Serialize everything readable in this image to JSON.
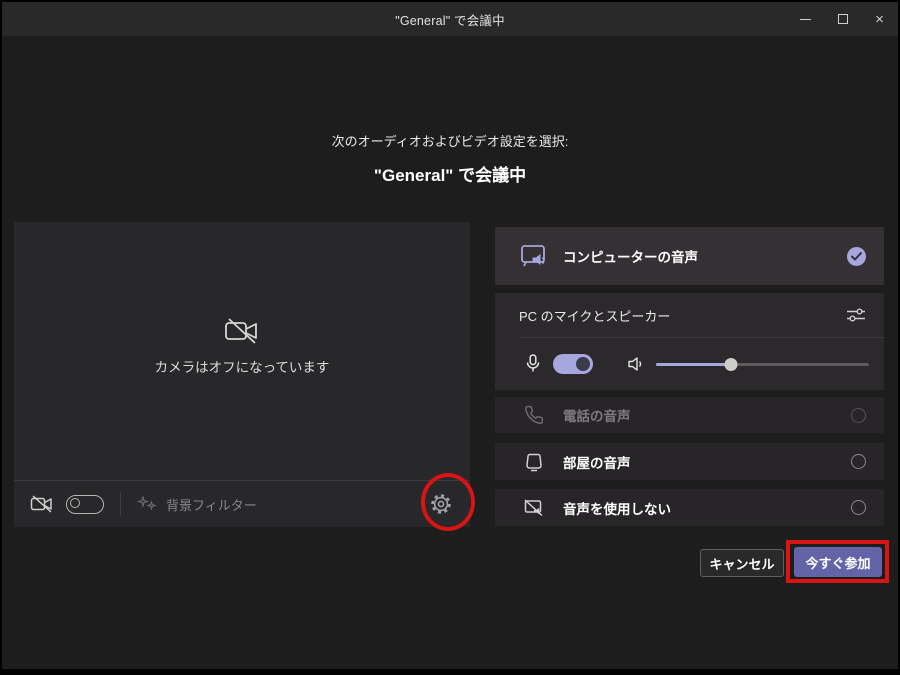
{
  "window": {
    "title": "\"General\" で会議中",
    "controls": {
      "minimize": "minimize",
      "maximize": "maximize",
      "close": "×"
    }
  },
  "header": {
    "subtitle": "次のオーディオおよびビデオ設定を選択:",
    "title": "\"General\" で会議中"
  },
  "video_preview": {
    "status_text": "カメラはオフになっています",
    "camera_toggle_on": false,
    "background_filter_label": "背景フィルター"
  },
  "audio_options": {
    "computer_audio": {
      "label": "コンピューターの音声",
      "selected": true
    },
    "device_settings": {
      "label": "PC のマイクとスピーカー",
      "mic_on": true,
      "volume_percent": 35
    },
    "phone_audio": {
      "label": "電話の音声",
      "disabled": true
    },
    "room_audio": {
      "label": "部屋の音声",
      "selected": false
    },
    "no_audio": {
      "label": "音声を使用しない",
      "selected": false
    }
  },
  "actions": {
    "cancel_label": "キャンセル",
    "join_label": "今すぐ参加"
  },
  "annotations": {
    "red_circle_target": "device-settings-gear",
    "red_box_target": "join-button",
    "color": "#d81414"
  },
  "colors": {
    "accent_purple": "#6264a7",
    "lavender": "#a6a7dc",
    "background": "#1e1d1e",
    "panel": "#282729",
    "selected_row": "#343034"
  }
}
